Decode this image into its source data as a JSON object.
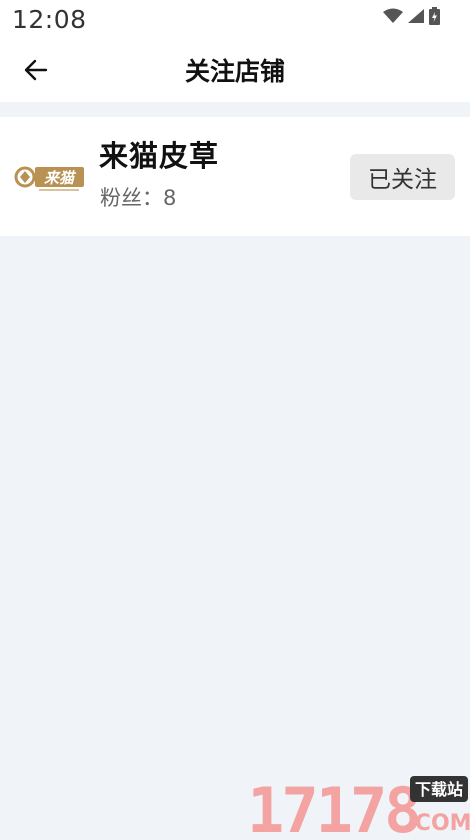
{
  "status_bar": {
    "time": "12:08",
    "icons": [
      "wifi-icon",
      "signal-icon",
      "battery-icon"
    ]
  },
  "header": {
    "back_icon": "arrow-left-icon",
    "title": "关注店铺"
  },
  "shops": [
    {
      "logo_text": "来猫",
      "name": "来猫皮草",
      "fans_label": "粉丝：",
      "fans_count": "8",
      "follow_label": "已关注"
    }
  ],
  "watermark": {
    "brand_number": "17178",
    "tag": "下载站",
    "domain": ".COM"
  },
  "colors": {
    "background": "#f0f3f7",
    "card": "#ffffff",
    "logo_gold": "#b99152",
    "button_bg": "#e9e9e9",
    "watermark_pink": "#f4a3a3"
  }
}
